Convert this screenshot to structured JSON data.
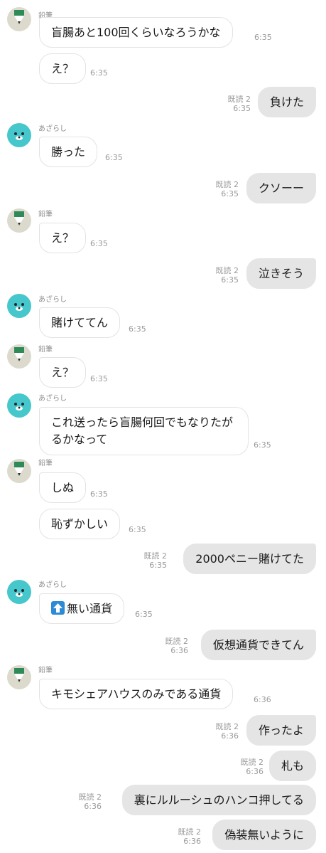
{
  "senders": {
    "pencil": "鉛筆",
    "seal": "あざらし"
  },
  "read_label": "既読 2",
  "messages": [
    {
      "text": "盲腸あと100回くらいなろうかな",
      "time": "6:35"
    },
    {
      "text": "え？",
      "time": "6:35"
    },
    {
      "text": "負けた",
      "time": "6:35"
    },
    {
      "text": "勝った",
      "time": "6:35"
    },
    {
      "text": "クソーー",
      "time": "6:35"
    },
    {
      "text": "え？",
      "time": "6:35"
    },
    {
      "text": "泣きそう",
      "time": "6:35"
    },
    {
      "text": "賭けててん",
      "time": "6:35"
    },
    {
      "text": "え？",
      "time": "6:35"
    },
    {
      "text": "これ送ったら盲腸何回でもなりたがるかなって",
      "time": "6:35"
    },
    {
      "text": "しぬ",
      "time": "6:35"
    },
    {
      "text": "恥ずかしい",
      "time": "6:35"
    },
    {
      "text": "2000ペニー賭けてた",
      "time": "6:35"
    },
    {
      "text": "無い通貨",
      "time": "6:35"
    },
    {
      "text": "仮想通貨できてん",
      "time": "6:36"
    },
    {
      "text": "キモシェアハウスのみである通貨",
      "time": "6:36"
    },
    {
      "text": "作ったよ",
      "time": "6:36"
    },
    {
      "text": "札も",
      "time": "6:36"
    },
    {
      "text": "裏にルルーシュのハンコ押してる",
      "time": "6:36"
    },
    {
      "text": "偽装無いように",
      "time": "6:36"
    }
  ],
  "colors": {
    "pencil_green": "#2e8a57",
    "seal_teal": "#46c7cc",
    "out_bubble": "#e5e5e5"
  }
}
